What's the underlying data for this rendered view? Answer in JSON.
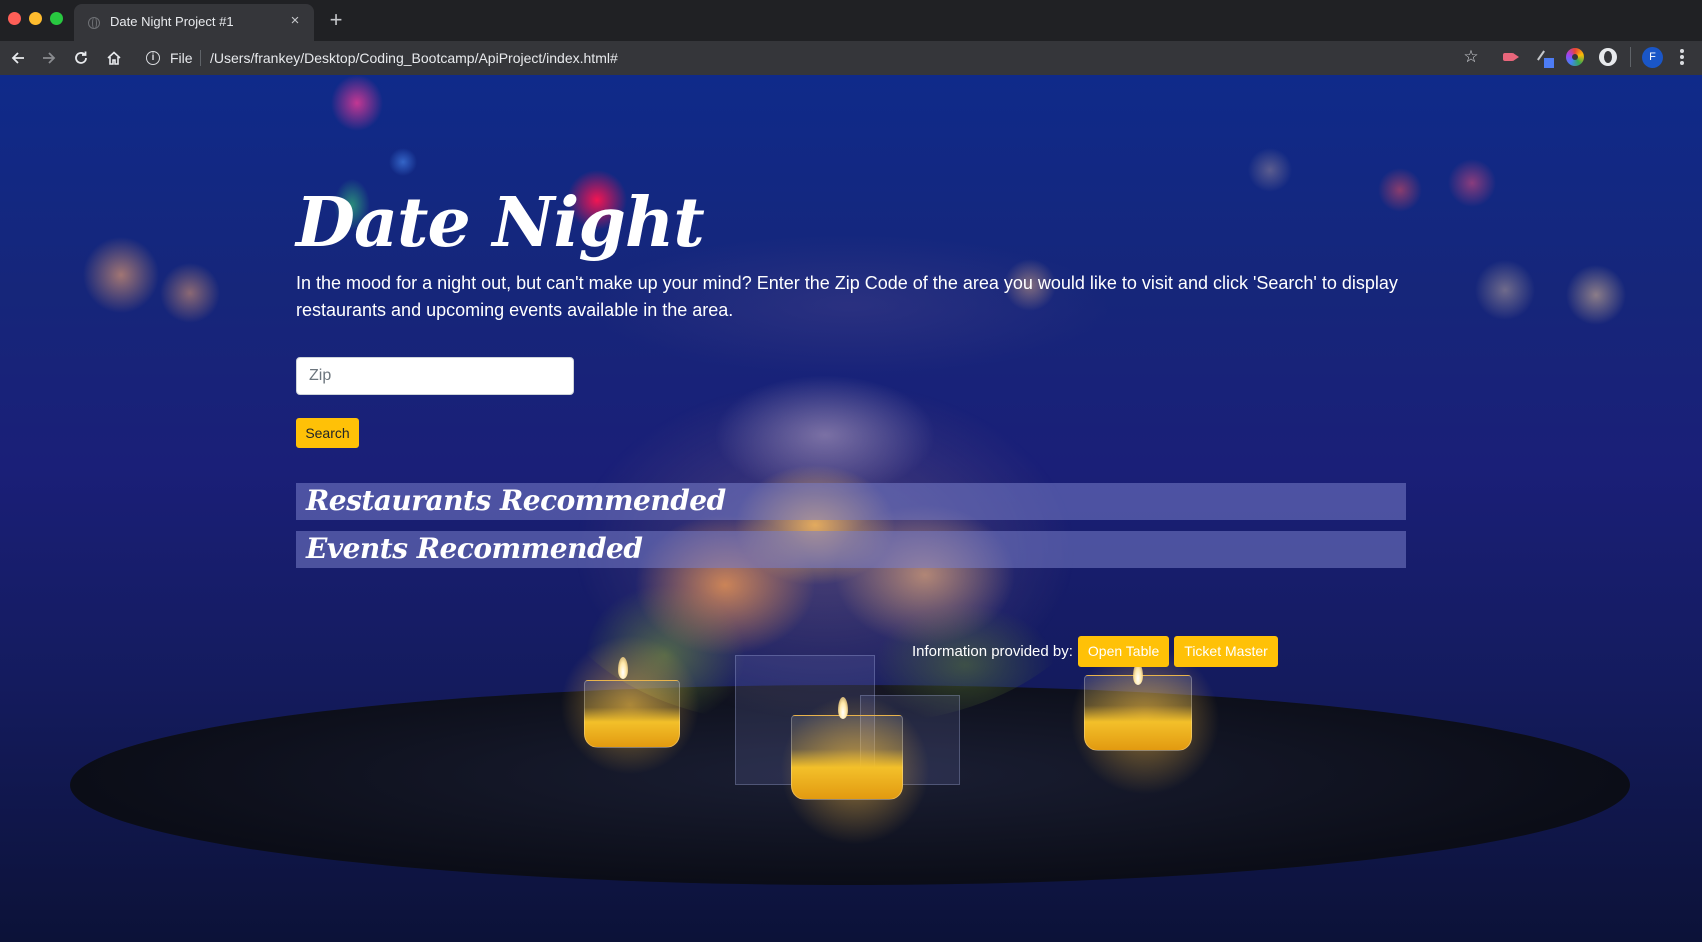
{
  "browser": {
    "tab_title": "Date Night Project #1",
    "tab_close_glyph": "×",
    "new_tab_glyph": "+",
    "url_scheme_label": "File",
    "url": "/Users/frankey/Desktop/Coding_Bootcamp/ApiProject/index.html#",
    "info_glyph": "i",
    "bookmark_glyph": "☆",
    "profile_initial": "F",
    "icons": [
      "back-icon",
      "forward-icon",
      "reload-icon",
      "home-icon",
      "info-icon",
      "star-icon",
      "extension-icons",
      "profile-avatar",
      "menu-icon"
    ]
  },
  "page": {
    "title": "Date Night",
    "intro": "In the mood for a night out, but can't make up your mind? Enter the Zip Code of the area you would like to visit and click 'Search' to display restaurants and upcoming events available in the area.",
    "search": {
      "placeholder": "Zip",
      "value": "",
      "button_label": "Search"
    },
    "sections": {
      "restaurants": "Restaurants Recommended",
      "events": "Events Recommended"
    },
    "footer": {
      "label": "Information provided by:",
      "links": [
        "Open Table",
        "Ticket Master"
      ]
    }
  },
  "colors": {
    "accent": "#ffc107",
    "section_bar": "#787dc8",
    "chrome_dark": "#202124",
    "chrome_toolbar": "#35363a",
    "background_blue": "#16267a"
  }
}
